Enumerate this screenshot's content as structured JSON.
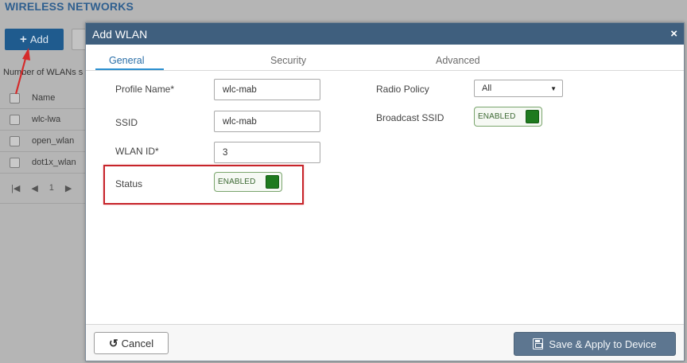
{
  "background": {
    "title": "WIRELESS NETWORKS",
    "add_label": "Add",
    "count_label": "Number of WLANs s",
    "table_header": "Name",
    "rows": [
      "wlc-lwa",
      "open_wlan",
      "dot1x_wlan"
    ],
    "pager_page": "1"
  },
  "modal": {
    "title": "Add WLAN",
    "close": "×",
    "tabs": {
      "general": "General",
      "security": "Security",
      "advanced": "Advanced"
    },
    "fields": {
      "profile_name_label": "Profile Name*",
      "profile_name_value": "wlc-mab",
      "ssid_label": "SSID",
      "ssid_value": "wlc-mab",
      "wlan_id_label": "WLAN ID*",
      "wlan_id_value": "3",
      "status_label": "Status",
      "status_toggle": "ENABLED",
      "radio_policy_label": "Radio Policy",
      "radio_policy_value": "All",
      "broadcast_ssid_label": "Broadcast SSID",
      "broadcast_ssid_toggle": "ENABLED"
    },
    "footer": {
      "cancel": "Cancel",
      "save": "Save & Apply to Device"
    }
  },
  "colors": {
    "header": "#3f5f7e",
    "accent": "#2a8fd0",
    "toggle_on": "#1e7a1e",
    "highlight": "#c7242a"
  },
  "icons": {
    "cancel": "undo-icon",
    "save": "save-icon",
    "close": "close-icon"
  }
}
